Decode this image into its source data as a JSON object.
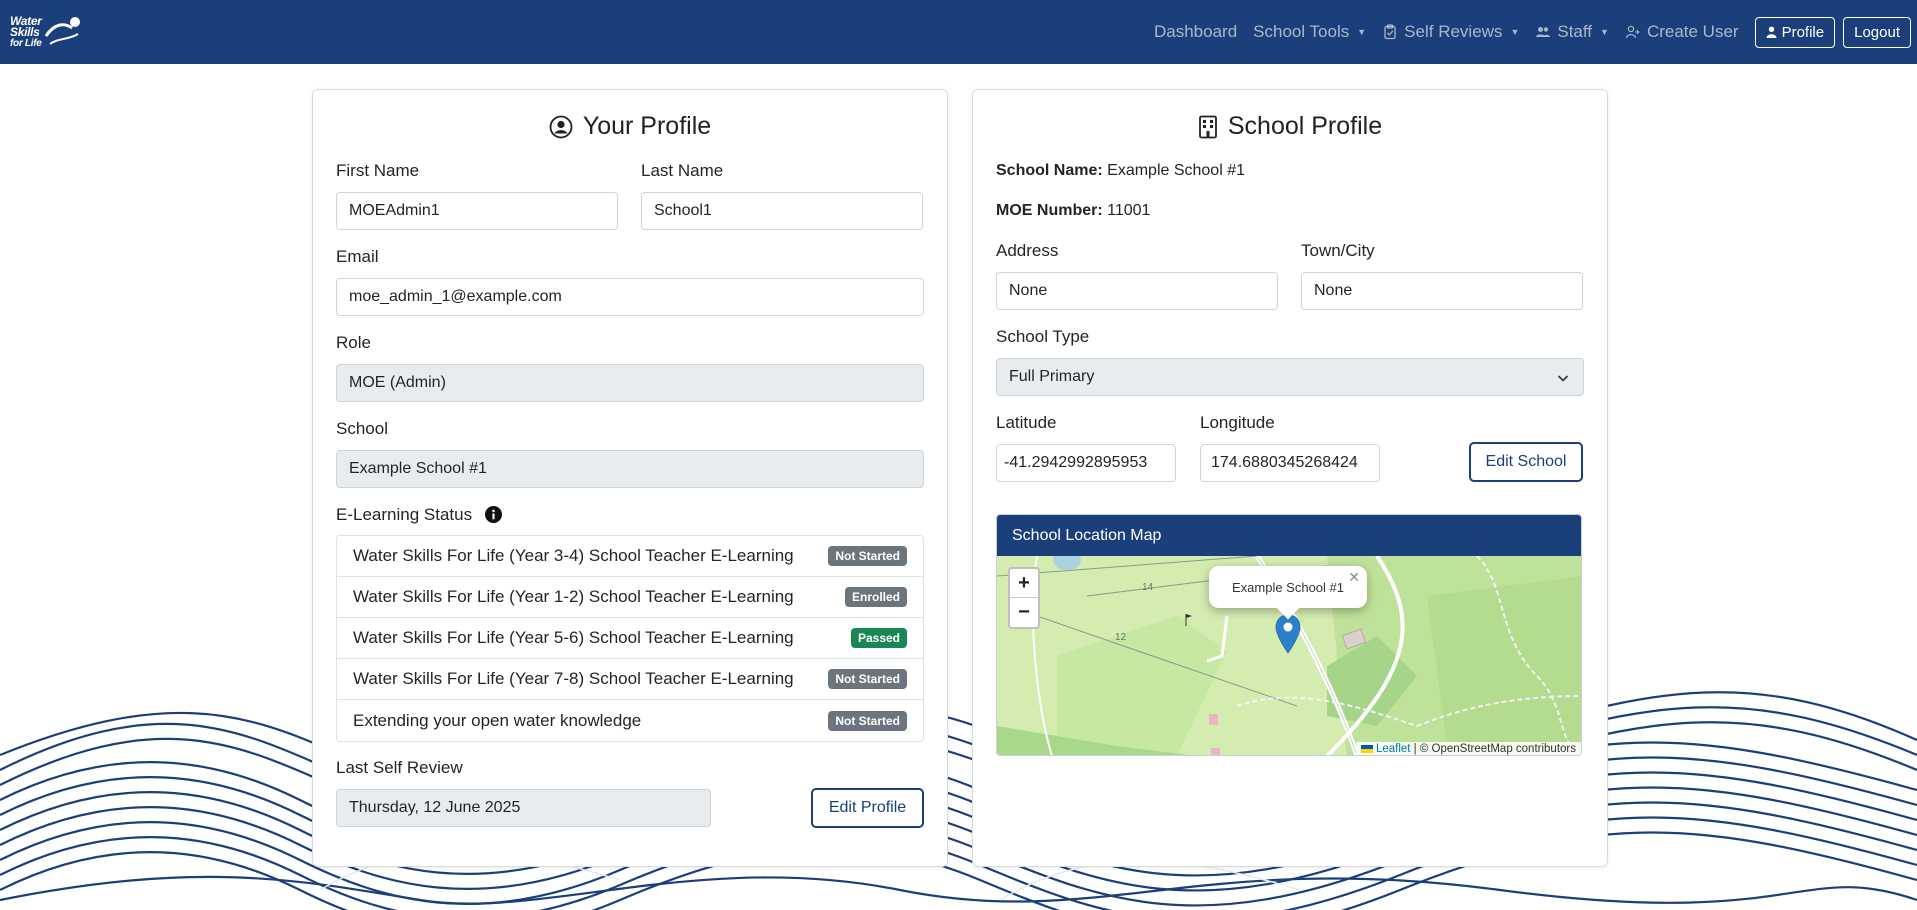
{
  "brand": {
    "line1": "Water",
    "line2": "Skills",
    "line3": "for Life"
  },
  "nav": {
    "dashboard": "Dashboard",
    "school_tools": "School Tools",
    "self_reviews": "Self Reviews",
    "staff": "Staff",
    "create_user": "Create User",
    "profile": "Profile",
    "logout": "Logout"
  },
  "profile": {
    "title": "Your Profile",
    "first_name_label": "First Name",
    "first_name": "MOEAdmin1",
    "last_name_label": "Last Name",
    "last_name": "School1",
    "email_label": "Email",
    "email": "moe_admin_1@example.com",
    "role_label": "Role",
    "role": "MOE (Admin)",
    "school_label": "School",
    "school": "Example School #1",
    "elearning_label": "E-Learning Status",
    "elearning": [
      {
        "name": "Water Skills For Life (Year 3-4) School Teacher E-Learning",
        "status": "Not Started"
      },
      {
        "name": "Water Skills For Life (Year 1-2) School Teacher E-Learning",
        "status": "Enrolled"
      },
      {
        "name": "Water Skills For Life (Year 5-6) School Teacher E-Learning",
        "status": "Passed"
      },
      {
        "name": "Water Skills For Life (Year 7-8) School Teacher E-Learning",
        "status": "Not Started"
      },
      {
        "name": "Extending your open water knowledge",
        "status": "Not Started"
      }
    ],
    "last_review_label": "Last Self Review",
    "last_review": "Thursday, 12 June 2025",
    "edit_button": "Edit Profile"
  },
  "school": {
    "title": "School Profile",
    "name_label": "School Name:",
    "name": "Example School #1",
    "moe_label": "MOE Number:",
    "moe": "11001",
    "address_label": "Address",
    "address": "None",
    "town_label": "Town/City",
    "town": "None",
    "type_label": "School Type",
    "type": "Full Primary",
    "lat_label": "Latitude",
    "lat": "-41.2942992895953",
    "lng_label": "Longitude",
    "lng": "174.6880345268424",
    "edit_button": "Edit School",
    "map_title": "School Location Map",
    "popup": "Example School #1",
    "zoom_in": "+",
    "zoom_out": "−",
    "attrib_leaflet": "Leaflet",
    "attrib_rest": " | © OpenStreetMap contributors",
    "map_labels": [
      "14",
      "12"
    ]
  },
  "colors": {
    "navy": "#1b3f7a",
    "passed": "#198754",
    "badge": "#6c757d"
  }
}
